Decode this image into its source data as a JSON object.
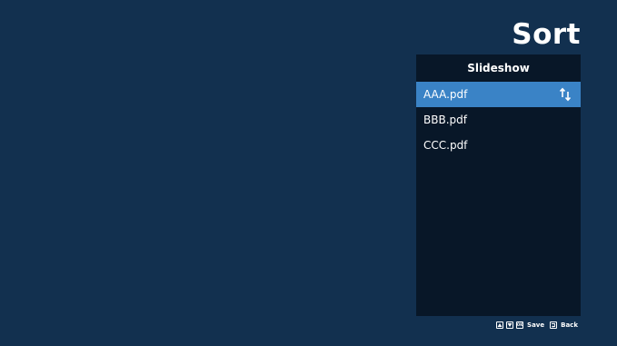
{
  "page": {
    "title": "Sort"
  },
  "panel": {
    "header": "Slideshow",
    "items": [
      {
        "label": "AAA.pdf",
        "selected": true
      },
      {
        "label": "BBB.pdf",
        "selected": false
      },
      {
        "label": "CCC.pdf",
        "selected": false
      }
    ]
  },
  "footer": {
    "up_icon": "up-key-icon",
    "down_icon": "down-key-icon",
    "ok_icon": "ok-key-icon",
    "ok_key": "OK",
    "save_label": "Save",
    "back_icon": "back-key-icon",
    "back_label": "Back"
  },
  "colors": {
    "background": "#12304f",
    "panel": "#081728",
    "selection": "#3a83c6",
    "text": "#ffffff"
  }
}
